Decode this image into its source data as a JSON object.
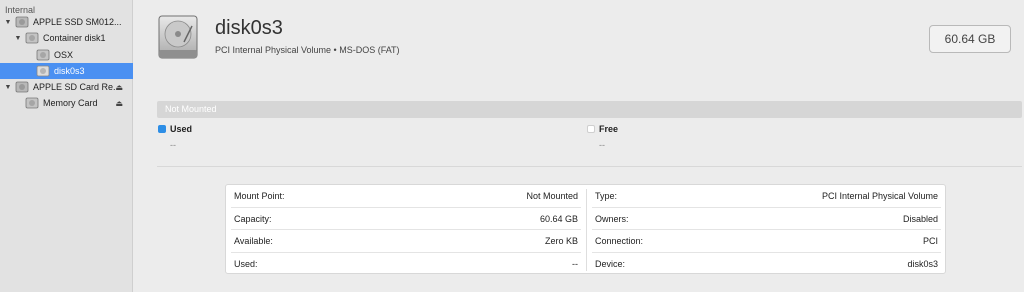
{
  "sidebar": {
    "section_label": "Internal",
    "items": [
      {
        "label": "APPLE SSD SM012...",
        "expanded": true,
        "eject": false
      },
      {
        "label": "Container disk1",
        "expanded": true,
        "eject": false
      },
      {
        "label": "OSX",
        "eject": false
      },
      {
        "label": "disk0s3",
        "selected": true,
        "eject": false
      },
      {
        "label": "APPLE SD Card Re...",
        "expanded": true,
        "eject": true
      },
      {
        "label": "Memory Card",
        "eject": true
      }
    ],
    "expand_glyph": "▼",
    "eject_glyph": "⏏"
  },
  "header": {
    "title": "disk0s3",
    "subtitle": "PCI Internal Physical Volume • MS-DOS (FAT)",
    "size": "60.64 GB"
  },
  "usage": {
    "bar_label": "Not Mounted",
    "used": {
      "label": "Used",
      "value": "--",
      "color": "#2d8ee6"
    },
    "free": {
      "label": "Free",
      "value": "--",
      "color": "#ffffff"
    }
  },
  "info": {
    "left": [
      {
        "label": "Mount Point:",
        "value": "Not Mounted"
      },
      {
        "label": "Capacity:",
        "value": "60.64 GB"
      },
      {
        "label": "Available:",
        "value": "Zero KB"
      },
      {
        "label": "Used:",
        "value": "--"
      }
    ],
    "right": [
      {
        "label": "Type:",
        "value": "PCI Internal Physical Volume"
      },
      {
        "label": "Owners:",
        "value": "Disabled"
      },
      {
        "label": "Connection:",
        "value": "PCI"
      },
      {
        "label": "Device:",
        "value": "disk0s3"
      }
    ]
  },
  "colors": {
    "accent": "#4a90f2",
    "used": "#2d8ee6"
  }
}
